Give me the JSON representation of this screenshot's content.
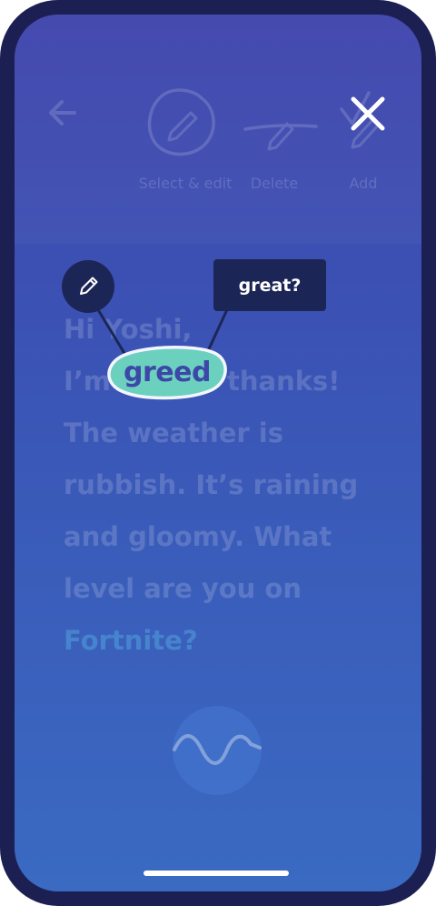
{
  "toolbar": {
    "tools": [
      {
        "label": "Select & edit",
        "icon": "pencil-circle-icon"
      },
      {
        "label": "Delete",
        "icon": "strike-pencil-icon"
      },
      {
        "label": "Add",
        "icon": "check-pencil-icon"
      }
    ],
    "back_icon": "back-arrow-icon",
    "close_icon": "close-icon"
  },
  "message": {
    "lines": [
      "Hi Yoshi,",
      "I’m",
      "thanks!",
      "The weather is",
      "rubbish. It’s raining",
      "and gloomy. What",
      "level are you on"
    ],
    "link_text": "Fortnite?"
  },
  "correction": {
    "selected_word": "greed",
    "suggestion": "great?",
    "edit_icon": "pencil-icon"
  },
  "voice": {
    "icon": "waveform-icon"
  },
  "colors": {
    "frame": "#1c1f52",
    "bubble": "#1c2656",
    "highlight": "#6cd0bf",
    "word": "#3d47a8"
  }
}
